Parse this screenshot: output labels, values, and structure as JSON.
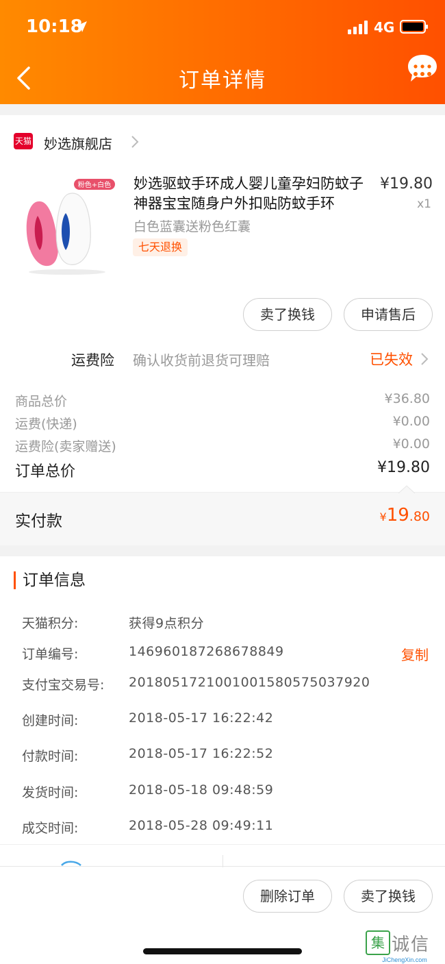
{
  "status_bar": {
    "time": "10:18",
    "network": "4G"
  },
  "nav": {
    "title": "订单详情"
  },
  "store": {
    "badge": "天猫",
    "name": "妙选旗舰店"
  },
  "product": {
    "title": "妙选驱蚊手环成人婴儿童孕妇防蚊子神器宝宝随身户外扣贴防蚊手环",
    "image_tag": "粉色+白色",
    "price": "¥19.80",
    "quantity": "x1",
    "spec": "白色蓝囊送粉色红囊",
    "return_badge": "七天退换",
    "buttons": {
      "sell": "卖了换钱",
      "after_sale": "申请售后"
    }
  },
  "insurance": {
    "label": "运费险",
    "desc": "确认收货前退货可理赔",
    "status": "已失效"
  },
  "fees": [
    {
      "label": "商品总价",
      "value": "¥36.80"
    },
    {
      "label": "运费(快递)",
      "value": "¥0.00"
    },
    {
      "label": "运费险(卖家赠送)",
      "value": "¥0.00"
    }
  ],
  "order_total": {
    "label": "订单总价",
    "value": "¥19.80"
  },
  "payment": {
    "label": "实付款",
    "currency": "¥",
    "integer": "19",
    "decimal": ".80"
  },
  "order_info": {
    "title": "订单信息",
    "copy_label": "复制",
    "rows": [
      {
        "label": "天猫积分:",
        "value": "获得9点积分"
      },
      {
        "label": "订单编号:",
        "value": "146960187268678849"
      },
      {
        "label": "支付宝交易号:",
        "value": "2018051721001001580575037920"
      },
      {
        "label": "创建时间:",
        "value": "2018-05-17 16:22:42"
      },
      {
        "label": "付款时间:",
        "value": "2018-05-17 16:22:52"
      },
      {
        "label": "发货时间:",
        "value": "2018-05-18 09:48:59"
      },
      {
        "label": "成交时间:",
        "value": "2018-05-28 09:49:11"
      }
    ]
  },
  "footer": {
    "delete_label": "删除订单",
    "sell_label": "卖了换钱"
  },
  "watermark": {
    "text": "诚信",
    "sub": "JiChengXin.com"
  },
  "colors": {
    "accent": "#ff5000",
    "header_start": "#ff8a00",
    "header_end": "#ff5000"
  }
}
